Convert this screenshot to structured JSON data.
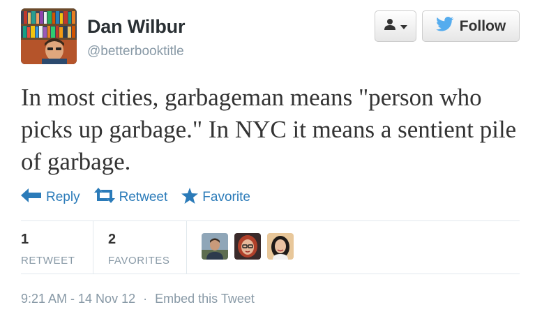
{
  "user": {
    "name": "Dan Wilbur",
    "handle": "@betterbooktitle"
  },
  "header": {
    "follow_label": "Follow"
  },
  "tweet": {
    "text": "In most cities, garbageman means \"person who picks up garbage.\" In NYC it means a sentient pile of garbage."
  },
  "actions": {
    "reply": "Reply",
    "retweet": "Retweet",
    "favorite": "Favorite"
  },
  "stats": {
    "retweets": {
      "count": "1",
      "label": "RETWEET"
    },
    "favorites": {
      "count": "2",
      "label": "FAVORITES"
    }
  },
  "footer": {
    "timestamp": "9:21 AM - 14 Nov 12",
    "separator": "·",
    "embed": "Embed this Tweet"
  },
  "colors": {
    "link": "#2b7bb9",
    "muted": "#8899a6",
    "twitter_bird": "#55acee"
  }
}
